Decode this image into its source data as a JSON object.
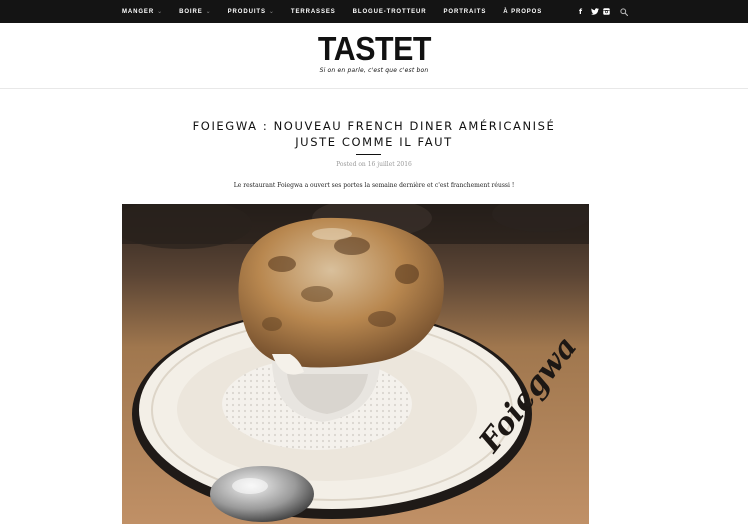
{
  "nav": {
    "items": [
      {
        "label": "MANGER",
        "has_dropdown": true
      },
      {
        "label": "BOIRE",
        "has_dropdown": true
      },
      {
        "label": "PRODUITS",
        "has_dropdown": true
      },
      {
        "label": "TERRASSES",
        "has_dropdown": false
      },
      {
        "label": "BLOGUE-TROTTEUR",
        "has_dropdown": false
      },
      {
        "label": "PORTRAITS",
        "has_dropdown": false
      },
      {
        "label": "À PROPOS",
        "has_dropdown": false
      }
    ],
    "dropdown_glyph": "⌄",
    "social": [
      {
        "name": "facebook-icon",
        "glyph": "f"
      },
      {
        "name": "twitter-icon",
        "glyph": "t"
      },
      {
        "name": "instagram-icon",
        "glyph": "◘"
      },
      {
        "name": "search-icon",
        "glyph": "⚲"
      }
    ]
  },
  "header": {
    "logo": "TASTET",
    "tagline": "Si on en parle, c'est que c'est bon"
  },
  "post": {
    "title_line1": "FOIEGWA : NOUVEAU FRENCH DINER AMÉRICANISÉ",
    "title_line2": "JUSTE COMME IL FAUT",
    "meta": "Posted on 16 juillet 2016",
    "excerpt": "Le restaurant Foiegwa a ouvert ses portes la semaine dernière et c'est franchement réussi !",
    "image": {
      "subject": "french-onion-soup-bowl",
      "plate_text": "Foiegwa"
    }
  },
  "colors": {
    "topbar": "#141414",
    "text": "#111111",
    "meta": "#999999"
  }
}
